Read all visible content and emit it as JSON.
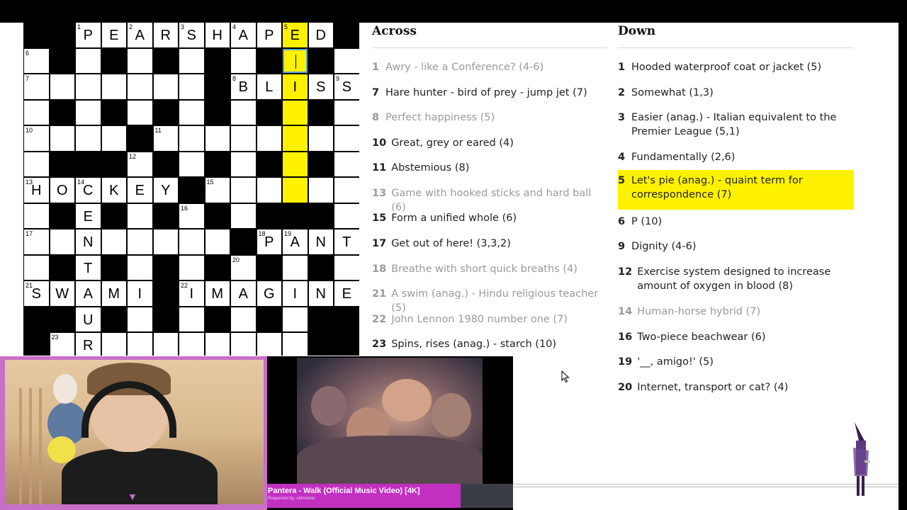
{
  "grid": {
    "rows": [
      "##PEARSHAPED#",
      ".#.#.#.#.#.#.",
      ".........BLISS",
      ".#.#.#.#.#.#.",
      "....#........",
      ".#####.#.#.#.",
      "HOCKEY#......",
      ".#E#.#.#.###.",
      "..N......#PANT",
      ".#T#.#.#.#.#.",
      "SWAMI#IMAGINE",
      "##U#.#.#.#.#.",
      "##R.........."
    ],
    "cells": [
      {
        "r": 0,
        "c": 0,
        "b": true
      },
      {
        "r": 0,
        "c": 1,
        "b": true
      },
      {
        "r": 0,
        "c": 2,
        "n": "1",
        "l": "P"
      },
      {
        "r": 0,
        "c": 3,
        "l": "E"
      },
      {
        "r": 0,
        "c": 4,
        "n": "2",
        "l": "A"
      },
      {
        "r": 0,
        "c": 5,
        "l": "R"
      },
      {
        "r": 0,
        "c": 6,
        "n": "3",
        "l": "S"
      },
      {
        "r": 0,
        "c": 7,
        "l": "H"
      },
      {
        "r": 0,
        "c": 8,
        "n": "4",
        "l": "A"
      },
      {
        "r": 0,
        "c": 9,
        "l": "P"
      },
      {
        "r": 0,
        "c": 10,
        "n": "5",
        "l": "E",
        "h": true
      },
      {
        "r": 0,
        "c": 11,
        "l": "D"
      },
      {
        "r": 0,
        "c": 12,
        "b": true
      },
      {
        "r": 1,
        "c": 0,
        "n": "6"
      },
      {
        "r": 1,
        "c": 1,
        "b": true
      },
      {
        "r": 1,
        "c": 2
      },
      {
        "r": 1,
        "c": 3,
        "b": true
      },
      {
        "r": 1,
        "c": 4
      },
      {
        "r": 1,
        "c": 5,
        "b": true
      },
      {
        "r": 1,
        "c": 6
      },
      {
        "r": 1,
        "c": 7,
        "b": true
      },
      {
        "r": 1,
        "c": 8
      },
      {
        "r": 1,
        "c": 9,
        "b": true
      },
      {
        "r": 1,
        "c": 10,
        "cur": true
      },
      {
        "r": 1,
        "c": 11,
        "b": true
      },
      {
        "r": 1,
        "c": 12
      },
      {
        "r": 2,
        "c": 0,
        "n": "7"
      },
      {
        "r": 2,
        "c": 1
      },
      {
        "r": 2,
        "c": 2
      },
      {
        "r": 2,
        "c": 3
      },
      {
        "r": 2,
        "c": 4
      },
      {
        "r": 2,
        "c": 5
      },
      {
        "r": 2,
        "c": 6
      },
      {
        "r": 2,
        "c": 7,
        "b": true
      },
      {
        "r": 2,
        "c": 8,
        "n": "8",
        "l": "B"
      },
      {
        "r": 2,
        "c": 9,
        "l": "L"
      },
      {
        "r": 2,
        "c": 10,
        "l": "I",
        "h": true
      },
      {
        "r": 2,
        "c": 11,
        "l": "S"
      },
      {
        "r": 2,
        "c": 12,
        "n": "9",
        "l": "S"
      },
      {
        "r": 3,
        "c": 0
      },
      {
        "r": 3,
        "c": 1,
        "b": true
      },
      {
        "r": 3,
        "c": 2
      },
      {
        "r": 3,
        "c": 3,
        "b": true
      },
      {
        "r": 3,
        "c": 4
      },
      {
        "r": 3,
        "c": 5,
        "b": true
      },
      {
        "r": 3,
        "c": 6
      },
      {
        "r": 3,
        "c": 7,
        "b": true
      },
      {
        "r": 3,
        "c": 8
      },
      {
        "r": 3,
        "c": 9,
        "b": true
      },
      {
        "r": 3,
        "c": 10,
        "h": true
      },
      {
        "r": 3,
        "c": 11,
        "b": true
      },
      {
        "r": 3,
        "c": 12
      },
      {
        "r": 4,
        "c": 0,
        "n": "10"
      },
      {
        "r": 4,
        "c": 1
      },
      {
        "r": 4,
        "c": 2
      },
      {
        "r": 4,
        "c": 3
      },
      {
        "r": 4,
        "c": 4,
        "b": true
      },
      {
        "r": 4,
        "c": 5,
        "n": "11"
      },
      {
        "r": 4,
        "c": 6
      },
      {
        "r": 4,
        "c": 7
      },
      {
        "r": 4,
        "c": 8
      },
      {
        "r": 4,
        "c": 9
      },
      {
        "r": 4,
        "c": 10,
        "h": true
      },
      {
        "r": 4,
        "c": 11
      },
      {
        "r": 4,
        "c": 12
      },
      {
        "r": 5,
        "c": 0
      },
      {
        "r": 5,
        "c": 1,
        "b": true
      },
      {
        "r": 5,
        "c": 2,
        "b": true
      },
      {
        "r": 5,
        "c": 3,
        "b": true
      },
      {
        "r": 5,
        "c": 4,
        "n": "12"
      },
      {
        "r": 5,
        "c": 5,
        "b": true
      },
      {
        "r": 5,
        "c": 6
      },
      {
        "r": 5,
        "c": 7,
        "b": true
      },
      {
        "r": 5,
        "c": 8
      },
      {
        "r": 5,
        "c": 9,
        "b": true
      },
      {
        "r": 5,
        "c": 10,
        "h": true
      },
      {
        "r": 5,
        "c": 11,
        "b": true
      },
      {
        "r": 5,
        "c": 12
      },
      {
        "r": 6,
        "c": 0,
        "n": "13",
        "l": "H"
      },
      {
        "r": 6,
        "c": 1,
        "l": "O"
      },
      {
        "r": 6,
        "c": 2,
        "n": "14",
        "l": "C"
      },
      {
        "r": 6,
        "c": 3,
        "l": "K"
      },
      {
        "r": 6,
        "c": 4,
        "l": "E"
      },
      {
        "r": 6,
        "c": 5,
        "l": "Y"
      },
      {
        "r": 6,
        "c": 6,
        "b": true
      },
      {
        "r": 6,
        "c": 7,
        "n": "15"
      },
      {
        "r": 6,
        "c": 8
      },
      {
        "r": 6,
        "c": 9
      },
      {
        "r": 6,
        "c": 10,
        "h": true
      },
      {
        "r": 6,
        "c": 11
      },
      {
        "r": 6,
        "c": 12
      },
      {
        "r": 7,
        "c": 0
      },
      {
        "r": 7,
        "c": 1,
        "b": true
      },
      {
        "r": 7,
        "c": 2,
        "l": "E"
      },
      {
        "r": 7,
        "c": 3,
        "b": true
      },
      {
        "r": 7,
        "c": 4
      },
      {
        "r": 7,
        "c": 5,
        "b": true
      },
      {
        "r": 7,
        "c": 6,
        "n": "16"
      },
      {
        "r": 7,
        "c": 7,
        "b": true
      },
      {
        "r": 7,
        "c": 8
      },
      {
        "r": 7,
        "c": 9,
        "b": true
      },
      {
        "r": 7,
        "c": 10,
        "b": true
      },
      {
        "r": 7,
        "c": 11,
        "b": true
      },
      {
        "r": 7,
        "c": 12
      },
      {
        "r": 8,
        "c": 0,
        "n": "17"
      },
      {
        "r": 8,
        "c": 1
      },
      {
        "r": 8,
        "c": 2,
        "l": "N"
      },
      {
        "r": 8,
        "c": 3
      },
      {
        "r": 8,
        "c": 4
      },
      {
        "r": 8,
        "c": 5
      },
      {
        "r": 8,
        "c": 6
      },
      {
        "r": 8,
        "c": 7
      },
      {
        "r": 8,
        "c": 8,
        "b": true
      },
      {
        "r": 8,
        "c": 9,
        "n": "18",
        "l": "P"
      },
      {
        "r": 8,
        "c": 10,
        "n": "19",
        "l": "A"
      },
      {
        "r": 8,
        "c": 11,
        "l": "N"
      },
      {
        "r": 8,
        "c": 12,
        "l": "T"
      },
      {
        "r": 9,
        "c": 0
      },
      {
        "r": 9,
        "c": 1,
        "b": true
      },
      {
        "r": 9,
        "c": 2,
        "l": "T"
      },
      {
        "r": 9,
        "c": 3,
        "b": true
      },
      {
        "r": 9,
        "c": 4
      },
      {
        "r": 9,
        "c": 5,
        "b": true
      },
      {
        "r": 9,
        "c": 6
      },
      {
        "r": 9,
        "c": 7,
        "b": true
      },
      {
        "r": 9,
        "c": 8,
        "n": "20"
      },
      {
        "r": 9,
        "c": 9,
        "b": true
      },
      {
        "r": 9,
        "c": 10
      },
      {
        "r": 9,
        "c": 11,
        "b": true
      },
      {
        "r": 9,
        "c": 12
      },
      {
        "r": 10,
        "c": 0,
        "n": "21",
        "l": "S"
      },
      {
        "r": 10,
        "c": 1,
        "l": "W"
      },
      {
        "r": 10,
        "c": 2,
        "l": "A"
      },
      {
        "r": 10,
        "c": 3,
        "l": "M"
      },
      {
        "r": 10,
        "c": 4,
        "l": "I"
      },
      {
        "r": 10,
        "c": 5,
        "b": true
      },
      {
        "r": 10,
        "c": 6,
        "n": "22",
        "l": "I"
      },
      {
        "r": 10,
        "c": 7,
        "l": "M"
      },
      {
        "r": 10,
        "c": 8,
        "l": "A"
      },
      {
        "r": 10,
        "c": 9,
        "l": "G"
      },
      {
        "r": 10,
        "c": 10,
        "l": "I"
      },
      {
        "r": 10,
        "c": 11,
        "l": "N"
      },
      {
        "r": 10,
        "c": 12,
        "l": "E"
      },
      {
        "r": 11,
        "c": 0,
        "b": true
      },
      {
        "r": 11,
        "c": 1,
        "b": true
      },
      {
        "r": 11,
        "c": 2,
        "l": "U"
      },
      {
        "r": 11,
        "c": 3,
        "b": true
      },
      {
        "r": 11,
        "c": 4
      },
      {
        "r": 11,
        "c": 5,
        "b": true
      },
      {
        "r": 11,
        "c": 6
      },
      {
        "r": 11,
        "c": 7,
        "b": true
      },
      {
        "r": 11,
        "c": 8
      },
      {
        "r": 11,
        "c": 9,
        "b": true
      },
      {
        "r": 11,
        "c": 10
      },
      {
        "r": 11,
        "c": 11,
        "b": true
      },
      {
        "r": 11,
        "c": 12,
        "b": true
      },
      {
        "r": 12,
        "c": 0,
        "b": true
      },
      {
        "r": 12,
        "c": 1,
        "n": "23"
      },
      {
        "r": 12,
        "c": 2,
        "l": "R"
      },
      {
        "r": 12,
        "c": 3
      },
      {
        "r": 12,
        "c": 4
      },
      {
        "r": 12,
        "c": 5
      },
      {
        "r": 12,
        "c": 6
      },
      {
        "r": 12,
        "c": 7
      },
      {
        "r": 12,
        "c": 8
      },
      {
        "r": 12,
        "c": 9
      },
      {
        "r": 12,
        "c": 10
      },
      {
        "r": 12,
        "c": 11,
        "b": true
      },
      {
        "r": 12,
        "c": 12,
        "b": true
      }
    ]
  },
  "across": {
    "heading": "Across",
    "clues": [
      {
        "num": "1",
        "text": "Awry - like a Conference? (4-6)",
        "done": true
      },
      {
        "num": "7",
        "text": "Hare hunter - bird of prey - jump jet (7)",
        "done": false
      },
      {
        "num": "8",
        "text": "Perfect happiness (5)",
        "done": true
      },
      {
        "num": "10",
        "text": "Great, grey or eared (4)",
        "done": false
      },
      {
        "num": "11",
        "text": "Abstemious (8)",
        "done": false
      },
      {
        "num": "13",
        "text": "Game with hooked sticks and hard ball (6)",
        "done": true
      },
      {
        "num": "15",
        "text": "Form a unified whole (6)",
        "done": false
      },
      {
        "num": "17",
        "text": "Get out of here! (3,3,2)",
        "done": false
      },
      {
        "num": "18",
        "text": "Breathe with short quick breaths (4)",
        "done": true
      },
      {
        "num": "21",
        "text": "A swim (anag.) - Hindu religious teacher (5)",
        "done": true
      },
      {
        "num": "22",
        "text": "John Lennon 1980 number one (7)",
        "done": true
      },
      {
        "num": "23",
        "text": "Spins, rises (anag.) - starch (10)",
        "done": false
      }
    ]
  },
  "down": {
    "heading": "Down",
    "clues": [
      {
        "num": "1",
        "text": "Hooded waterproof coat or jacket (5)",
        "done": false
      },
      {
        "num": "2",
        "text": "Somewhat (1,3)",
        "done": false
      },
      {
        "num": "3",
        "text": "Easier (anag.) - Italian equivalent to the Premier League (5,1)",
        "done": false
      },
      {
        "num": "4",
        "text": "Fundamentally (2,6)",
        "done": false
      },
      {
        "num": "5",
        "text": "Let's pie (anag.) - quaint term for correspondence (7)",
        "done": false,
        "active": true
      },
      {
        "num": "6",
        "text": "P (10)",
        "done": false
      },
      {
        "num": "9",
        "text": "Dignity (4-6)",
        "done": false
      },
      {
        "num": "12",
        "text": "Exercise system designed to increase amount of oxygen in blood (8)",
        "done": false
      },
      {
        "num": "14",
        "text": "Human-horse hybrid (7)",
        "done": true
      },
      {
        "num": "16",
        "text": "Two-piece beachwear (6)",
        "done": false
      },
      {
        "num": "19",
        "text": "'__, amigo!' (5)",
        "done": false
      },
      {
        "num": "20",
        "text": "Internet, transport or cat? (4)",
        "done": false
      }
    ]
  },
  "video": {
    "title": "Pantera - Walk (Official Music Video) [4K]",
    "requested_by": "Requested by: oldmanlar"
  },
  "colors": {
    "highlight": "#fff200",
    "overlay_accent": "#c230c2",
    "done_clue": "#9a9a9a"
  },
  "icons": {
    "cursor": "mouse-pointer-icon",
    "figure": "wizard-figure-icon"
  }
}
